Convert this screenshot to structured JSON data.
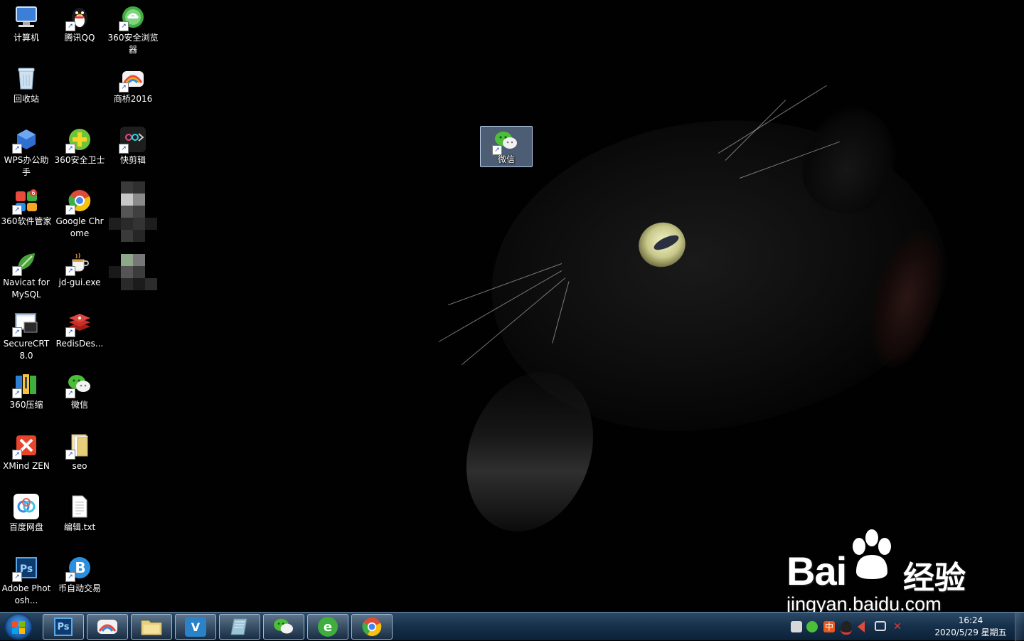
{
  "desktop": {
    "icons": [
      {
        "label": "计算机",
        "icon": "computer-icon",
        "color": "#3d7fd6"
      },
      {
        "label": "腾讯QQ",
        "icon": "qq-penguin-icon",
        "color": "#1a1a1a"
      },
      {
        "label": "360安全浏览器",
        "icon": "360-browser-icon",
        "color": "#3fae3f"
      },
      {
        "label": "回收站",
        "icon": "recycle-bin-icon",
        "color": "#a9c6dd"
      },
      {
        "label": "商桥2016",
        "icon": "shangqiao-icon",
        "color": "#e94b3c"
      },
      {
        "label": "WPS办公助手",
        "icon": "wps-icon",
        "color": "#2f6fd1"
      },
      {
        "label": "360安全卫士",
        "icon": "360-guard-icon",
        "color": "#6bc43a"
      },
      {
        "label": "快剪辑",
        "icon": "kuaijianji-icon",
        "color": "#222"
      },
      {
        "label": "360软件管家",
        "icon": "360-software-icon",
        "color": "#e84a3c"
      },
      {
        "label": "Google Chrome",
        "icon": "chrome-icon",
        "color": "#dd4b39"
      },
      {
        "label": "Navicat for MySQL",
        "icon": "navicat-icon",
        "color": "#4aa23c"
      },
      {
        "label": "jd-gui.exe",
        "icon": "jd-gui-cup-icon",
        "color": "#d9a441"
      },
      {
        "label": "SecureCRT 8.0",
        "icon": "securecrt-icon",
        "color": "#5b86b6"
      },
      {
        "label": "RedisDes...",
        "icon": "redis-icon",
        "color": "#c9302c"
      },
      {
        "label": "360压缩",
        "icon": "360-zip-icon",
        "color": "#2e7dd7"
      },
      {
        "label": "微信",
        "icon": "wechat-icon",
        "color": "#4cbf39"
      },
      {
        "label": "XMind ZEN",
        "icon": "xmind-icon",
        "color": "#e8452c"
      },
      {
        "label": "seo",
        "icon": "folder-icon",
        "color": "#e7cf7a"
      },
      {
        "label": "百度网盘",
        "icon": "baidu-netdisk-icon",
        "color": "#2f8de4"
      },
      {
        "label": "编辑.txt",
        "icon": "text-file-icon",
        "color": "#ffffff"
      },
      {
        "label": "Adobe Photosh...",
        "icon": "photoshop-icon",
        "color": "#0d3b6d"
      },
      {
        "label": "币自动交易",
        "icon": "coin-trade-icon",
        "color": "#2a8fe0"
      }
    ],
    "selected_icon": {
      "label": "微信",
      "icon": "wechat-icon"
    }
  },
  "taskbar": {
    "start_icon": "windows-start-icon",
    "pinned": [
      {
        "name": "photoshop",
        "icon": "photoshop-icon",
        "glyph": "Ps",
        "color": "#0d3b6d"
      },
      {
        "name": "shangqiao",
        "icon": "shangqiao-icon",
        "glyph": "",
        "color": "#e94b3c"
      },
      {
        "name": "explorer",
        "icon": "folder-icon",
        "glyph": "",
        "color": "#e7cf7a"
      },
      {
        "name": "vs",
        "icon": "visual-studio-icon",
        "glyph": "V",
        "color": "#2a82c9"
      },
      {
        "name": "notes",
        "icon": "notepad-icon",
        "glyph": "",
        "color": "#9ec5d6"
      },
      {
        "name": "wechat",
        "icon": "wechat-icon",
        "glyph": "",
        "color": "#4cbf39"
      },
      {
        "name": "360-browser",
        "icon": "360-browser-icon",
        "glyph": "e",
        "color": "#3fae3f"
      },
      {
        "name": "chrome",
        "icon": "chrome-icon",
        "glyph": "",
        "color": "#dd4b39"
      }
    ],
    "tray": {
      "icons": [
        "network-monitor-icon",
        "wechat-tray-icon",
        "ime-zhong-icon",
        "qq-tray-icon",
        "speaker-icon",
        "action-center-icon",
        "volume-muted-icon"
      ],
      "ime_label": "中",
      "time": "16:24",
      "date": "2020/5/29 星期五"
    }
  },
  "watermark": {
    "brand": "Bai",
    "suffix": "经验",
    "url": "jingyan.baidu.com"
  }
}
